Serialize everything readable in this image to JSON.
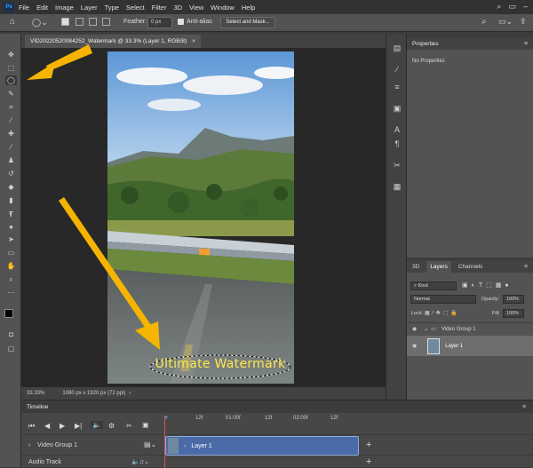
{
  "menu": [
    "File",
    "Edit",
    "Image",
    "Layer",
    "Type",
    "Select",
    "Filter",
    "3D",
    "View",
    "Window",
    "Help"
  ],
  "app_logo": "Ps",
  "options": {
    "feather_label": "Feather:",
    "feather_value": "0 px",
    "antialias_label": "Anti-alias",
    "select_mask_label": "Select and Mask..."
  },
  "document": {
    "tab_title": "VID20220520084252_Watermark @ 33.3% (Layer 1, RGB/8)",
    "close": "×",
    "watermark_text": "Ultimate Watermark"
  },
  "status": {
    "zoom": "33.33%",
    "info": "1080 px x 1920 px (72 ppi)"
  },
  "properties": {
    "title": "Properties",
    "no_props": "No Properties"
  },
  "layers_panel": {
    "tabs": [
      "3D",
      "Layers",
      "Channels"
    ],
    "kind": "Kind",
    "blend_mode": "Normal",
    "opacity_label": "Opacity:",
    "opacity_value": "100%",
    "lock_label": "Lock:",
    "fill_label": "Fill:",
    "fill_value": "100%",
    "group_name": "Video Group 1",
    "layer_name": "Layer 1"
  },
  "timeline": {
    "title": "Timeline",
    "ruler": [
      "12f",
      "01:00f",
      "12f",
      "02:00f",
      "12f"
    ],
    "track1": "Video Group 1",
    "track2": "Audio Track",
    "clip_label": "Layer 1"
  },
  "colors": {
    "accent": "#31a8ff",
    "arrow": "#f5b400",
    "watermark": "#ffe94d",
    "clip": "#4a6aa8"
  }
}
